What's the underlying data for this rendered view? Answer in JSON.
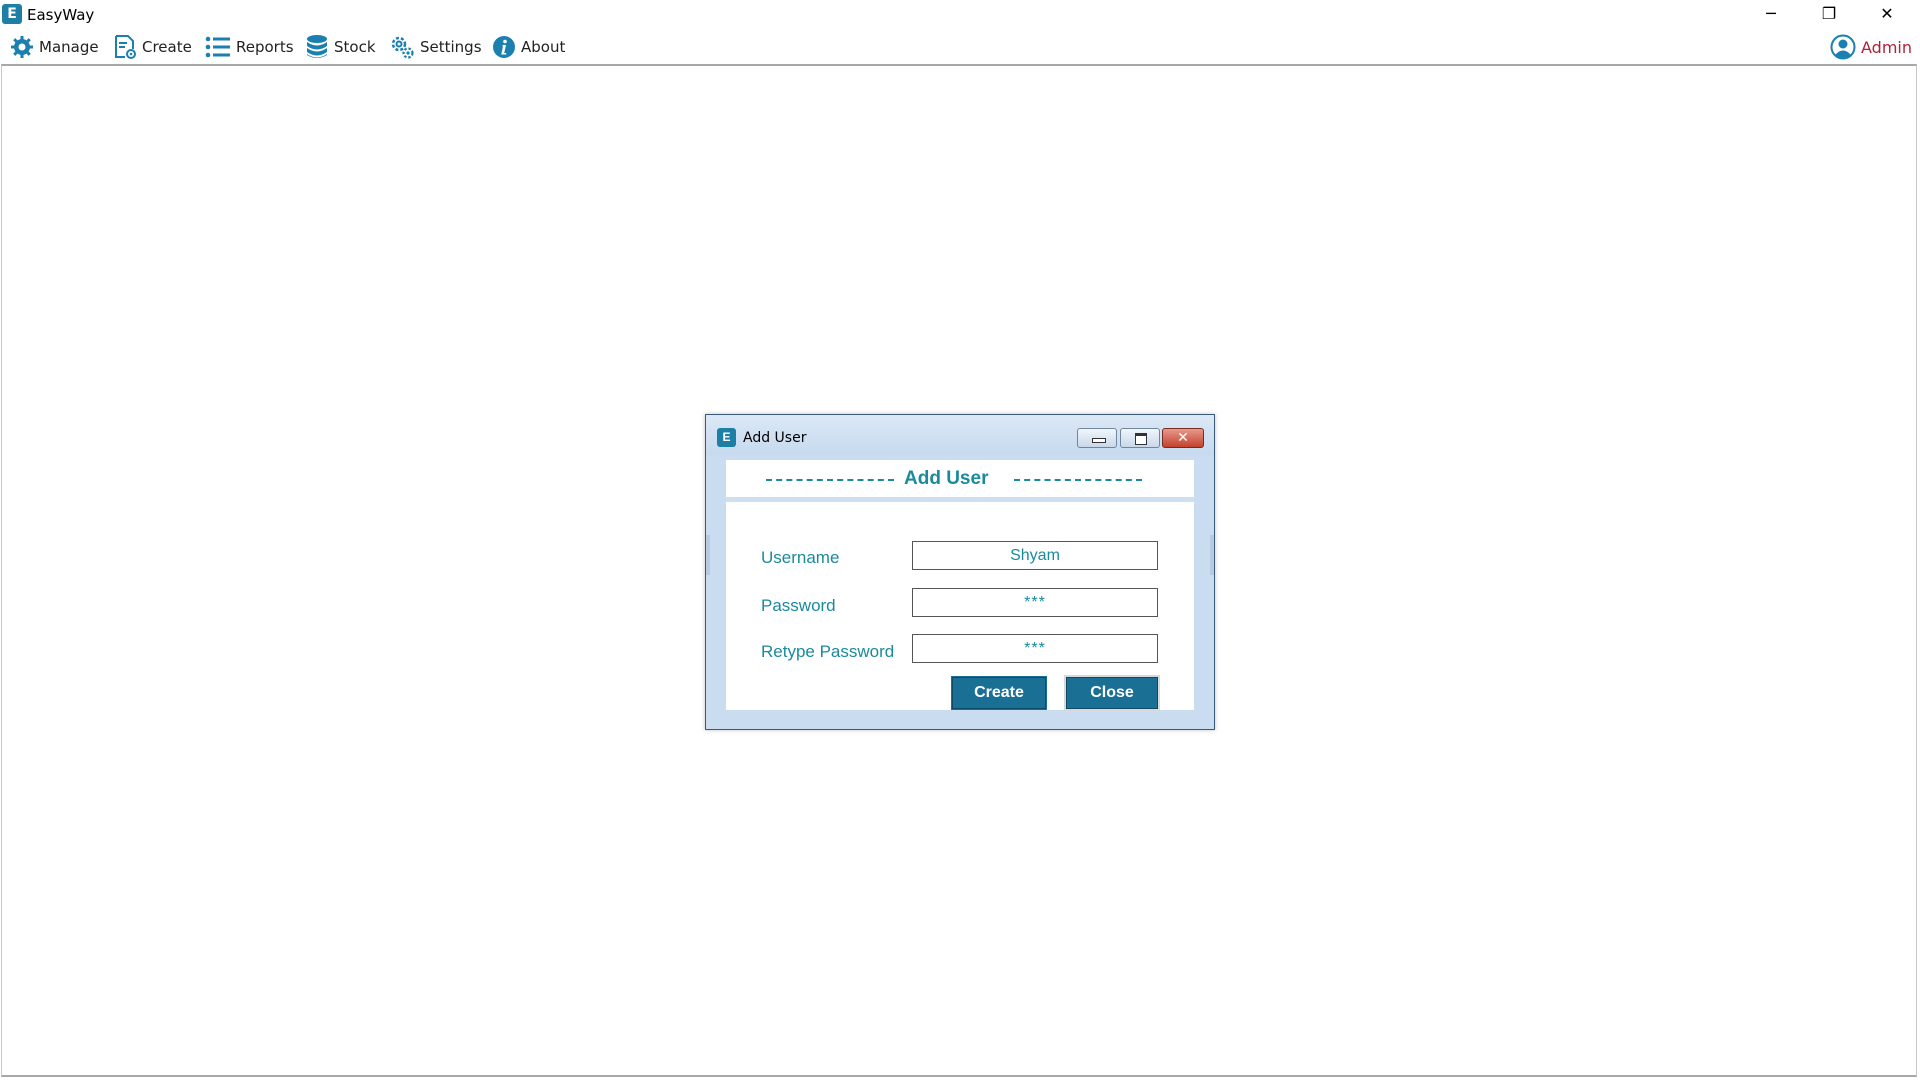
{
  "window": {
    "title": "EasyWay",
    "logo_letter": "E",
    "minimize_glyph": "─",
    "maximize_glyph": "❐",
    "close_glyph": "✕"
  },
  "menu": {
    "items": [
      {
        "label": "Manage",
        "icon": "gear-icon"
      },
      {
        "label": "Create",
        "icon": "create-document-icon"
      },
      {
        "label": "Reports",
        "icon": "list-icon"
      },
      {
        "label": "Stock",
        "icon": "database-icon"
      },
      {
        "label": "Settings",
        "icon": "settings-cogs-icon"
      },
      {
        "label": "About",
        "icon": "info-icon"
      }
    ],
    "user": {
      "label": "Admin",
      "icon": "user-avatar-icon"
    }
  },
  "dialog": {
    "title": "Add User",
    "logo_letter": "E",
    "close_glyph": "✕",
    "header_title": "Add User",
    "fields": {
      "username": {
        "label": "Username",
        "value": "Shyam"
      },
      "password": {
        "label": "Password",
        "value": "***"
      },
      "retype_password": {
        "label": "Retype Password",
        "value": "***"
      }
    },
    "buttons": {
      "create": "Create",
      "close": "Close"
    }
  },
  "colors": {
    "accent": "#1a8a9c",
    "button": "#1a6f95",
    "admin": "#b0213a",
    "dialog_frame": "#c9dcf0"
  }
}
